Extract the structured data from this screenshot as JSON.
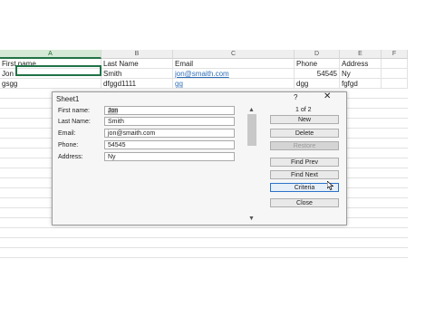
{
  "spreadsheet": {
    "columns": [
      "A",
      "B",
      "C",
      "D",
      "E",
      "F"
    ],
    "rows": [
      [
        "First name",
        "Last Name",
        "Email",
        "Phone",
        "Address"
      ],
      [
        "Jon",
        "Smith",
        "jon@smaith.com",
        "54545",
        "Ny"
      ],
      [
        "gsgg",
        "dfggd1111",
        "gg",
        "dgg",
        "fgfgd"
      ]
    ]
  },
  "dialog": {
    "title": "Sheet1",
    "help": "?",
    "close": "✕",
    "record_counter": "1 of 2",
    "fields": [
      {
        "label": "First name:",
        "value": "Jon"
      },
      {
        "label": "Last Name:",
        "value": "Smith"
      },
      {
        "label": "Email:",
        "value": "jon@smaith.com"
      },
      {
        "label": "Phone:",
        "value": "54545"
      },
      {
        "label": "Address:",
        "value": "Ny"
      }
    ],
    "buttons": {
      "new": "New",
      "delete": "Delete",
      "restore": "Restore",
      "find_prev": "Find Prev",
      "find_next": "Find Next",
      "criteria": "Criteria",
      "close": "Close"
    },
    "scroll_up": "▲",
    "scroll_down": "▼"
  }
}
